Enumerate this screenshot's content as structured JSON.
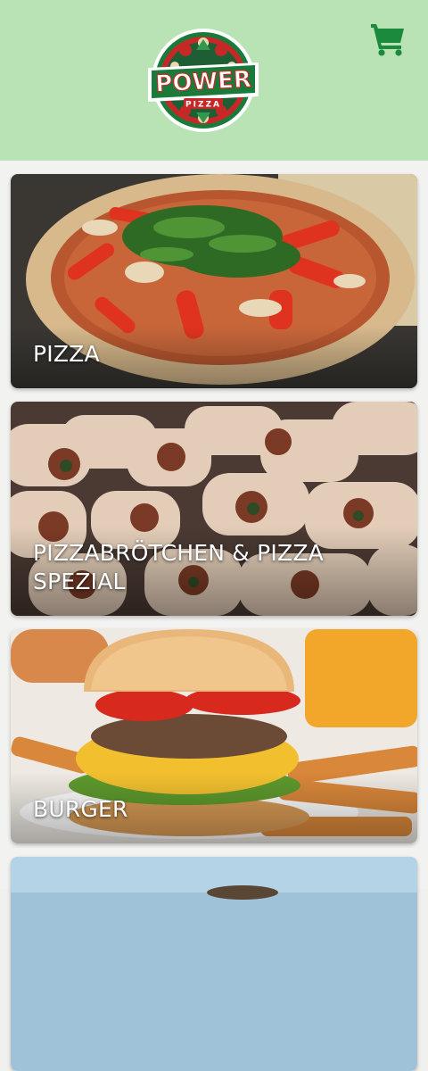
{
  "header": {
    "brand_logo_text_top": "POWER",
    "brand_logo_text_bottom": "PIZZA",
    "bg_color": "#b9e3b5",
    "cart_icon": "shopping-cart-icon",
    "cart_color": "#1b8a3c"
  },
  "categories": [
    {
      "label": "PIZZA"
    },
    {
      "label": "PIZZABRÖTCHEN & PIZZA SPEZIAL"
    },
    {
      "label": "BURGER"
    },
    {
      "label": ""
    }
  ]
}
